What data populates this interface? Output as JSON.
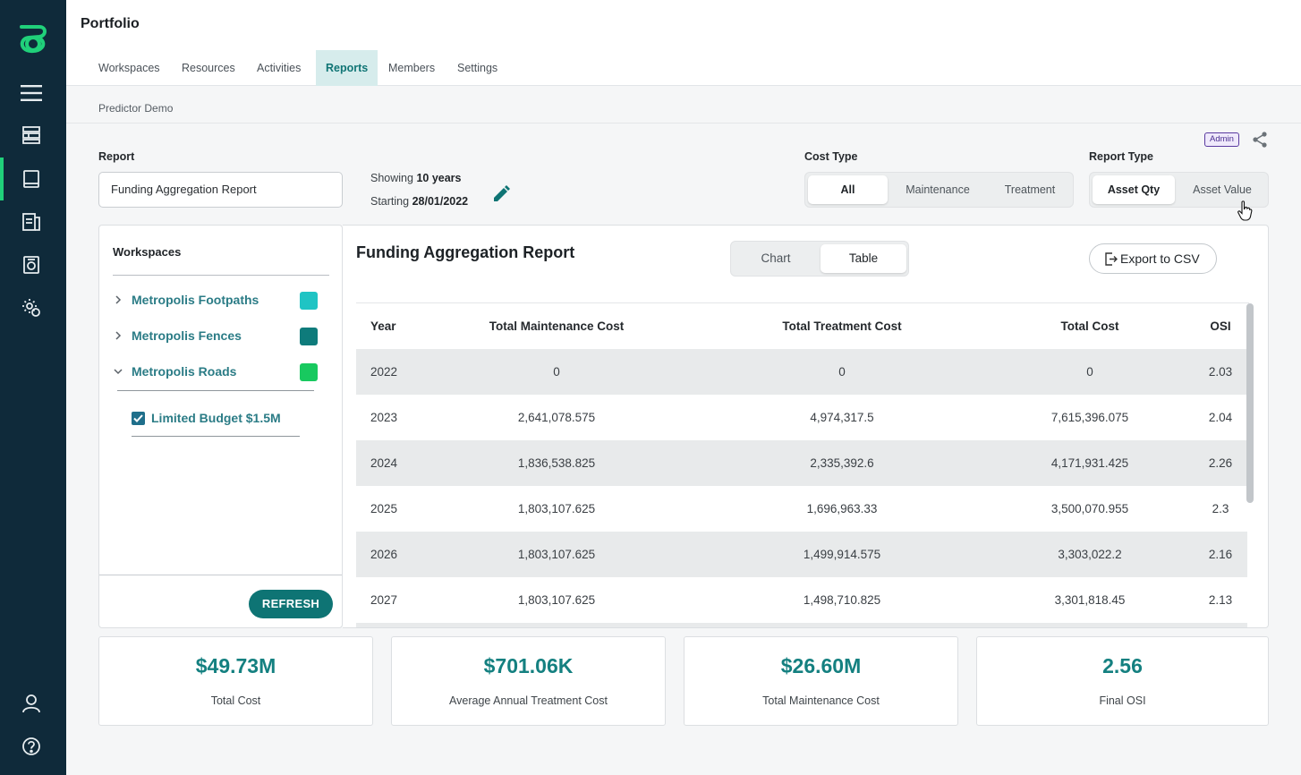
{
  "app": {
    "title": "Portfolio"
  },
  "nav": {
    "tabs": [
      {
        "label": "Workspaces"
      },
      {
        "label": "Resources"
      },
      {
        "label": "Activities"
      },
      {
        "label": "Reports",
        "active": true
      },
      {
        "label": "Members"
      },
      {
        "label": "Settings"
      }
    ]
  },
  "breadcrumb": "Predictor Demo",
  "badge": "Admin",
  "report": {
    "label": "Report",
    "value": "Funding Aggregation Report",
    "showing_prefix": "Showing",
    "showing_value": "10 years",
    "starting_prefix": "Starting",
    "starting_value": "28/01/2022"
  },
  "cost_type": {
    "label": "Cost Type",
    "options": [
      "All",
      "Maintenance",
      "Treatment"
    ],
    "selected": "All"
  },
  "report_type": {
    "label": "Report Type",
    "options": [
      "Asset Qty",
      "Asset Value"
    ],
    "selected": "Asset Qty"
  },
  "workspaces": {
    "title": "Workspaces",
    "items": [
      {
        "name": "Metropolis Footpaths",
        "color": "#1fc4c4",
        "expanded": false
      },
      {
        "name": "Metropolis Fences",
        "color": "#0e7b7b",
        "expanded": false
      },
      {
        "name": "Metropolis Roads",
        "color": "#18c95f",
        "expanded": true
      }
    ],
    "scenario": {
      "name": "Limited Budget $1.5M",
      "checked": true
    },
    "refresh_label": "REFRESH"
  },
  "main": {
    "title": "Funding Aggregation Report",
    "view_toggle": {
      "options": [
        "Chart",
        "Table"
      ],
      "selected": "Table"
    },
    "export_label": "Export to CSV",
    "table": {
      "headers": [
        "Year",
        "Total Maintenance Cost",
        "Total Treatment Cost",
        "Total Cost",
        "OSI"
      ],
      "rows": [
        [
          "2022",
          "0",
          "0",
          "0",
          "2.03"
        ],
        [
          "2023",
          "2,641,078.575",
          "4,974,317.5",
          "7,615,396.075",
          "2.04"
        ],
        [
          "2024",
          "1,836,538.825",
          "2,335,392.6",
          "4,171,931.425",
          "2.26"
        ],
        [
          "2025",
          "1,803,107.625",
          "1,696,963.33",
          "3,500,070.955",
          "2.3"
        ],
        [
          "2026",
          "1,803,107.625",
          "1,499,914.575",
          "3,303,022.2",
          "2.16"
        ],
        [
          "2027",
          "1,803,107.625",
          "1,498,710.825",
          "3,301,818.45",
          "2.13"
        ]
      ]
    }
  },
  "stats": [
    {
      "value": "$49.73M",
      "label": "Total Cost"
    },
    {
      "value": "$701.06K",
      "label": "Average Annual Treatment Cost"
    },
    {
      "value": "$26.60M",
      "label": "Total Maintenance Cost"
    },
    {
      "value": "2.56",
      "label": "Final OSI"
    }
  ],
  "colors": {
    "rail": "#0f2a3a",
    "accent": "#0e7474",
    "brand": "#20d07a"
  }
}
